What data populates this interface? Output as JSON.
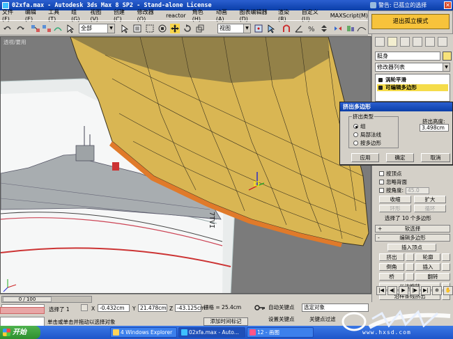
{
  "window": {
    "title": "02xfa.max - Autodesk 3ds Max 8 SP2 - Stand-alone License"
  },
  "warning": {
    "title": "警告: 已孤立的选择",
    "button": "退出孤立模式"
  },
  "menu": [
    "文件(F)",
    "编辑(E)",
    "工具(T)",
    "组(G)",
    "视图(V)",
    "创建(C)",
    "修改器(O)",
    "reactor",
    "角色(H)",
    "动画(A)",
    "图表编辑器(D)",
    "渲染(R)",
    "自定义(U)",
    "MAXScript(M)"
  ],
  "toolbar": {
    "selection_filter": "全部",
    "reference_coord": "视图"
  },
  "viewport": {
    "label": "透视/要用"
  },
  "command_panel": {
    "object_name": "艇身",
    "modifier_list": "修改器列表",
    "stack": [
      "涡轮平滑",
      "可编辑多边形"
    ],
    "options": {
      "by_vertex": "按顶点",
      "ignore_backfacing": "忽略背面",
      "by_angle": "按角度:",
      "angle_value": "45.0"
    },
    "buttons": {
      "shrink": "收缩",
      "grow": "扩大",
      "ring": "环形",
      "loop": "循环"
    },
    "selection_info": "选择了 10 个多边形",
    "rollouts": {
      "soft_selection": "软选择",
      "edit_polygons": "编辑多边形"
    },
    "poly_buttons": {
      "insert_vertex": "插入顶点",
      "extrude": "挤出",
      "outline": "轮廓",
      "bevel": "倒角",
      "inset": "插入",
      "bridge": "桥",
      "flip": "翻转",
      "hinge": "从边旋转",
      "extrude_along_spline": "沿样条线挤出"
    }
  },
  "extrude_dialog": {
    "title": "挤出多边形",
    "group_label": "挤出类型",
    "options": [
      "组",
      "局部法线",
      "按多边形"
    ],
    "height_label": "挤出高度:",
    "height_value": "3.498cm",
    "apply": "应用",
    "ok": "确定",
    "cancel": "取消"
  },
  "status": {
    "time_slider": "0 / 100",
    "selected_count": "选择了 1",
    "x_label": "X",
    "x_value": "-0.432cm",
    "y_label": "Y",
    "y_value": "21.478cm",
    "z_label": "Z",
    "z_value": "-43.125cm",
    "grid": "栅格 = 25.4cm",
    "prompt": "单击或单击并拖动以选择对象",
    "add_time_tag": "添加时间标记",
    "auto_key": "自动关键点",
    "set_key": "设置关键点",
    "selection_set": "选定对象",
    "key_filters": "关键点过滤"
  },
  "taskbar": {
    "start": "开始",
    "tasks": [
      "4 Windows Explorer",
      "02xfa.max - Auto...",
      "12 - 画图"
    ]
  },
  "watermark": {
    "url": "www.hxsd.com"
  },
  "colors": {
    "hull": "#d9b653",
    "selection": "#f5dc4a",
    "title_blue": "#0a3ea8",
    "viewport_bg": "#7b7b7b"
  }
}
